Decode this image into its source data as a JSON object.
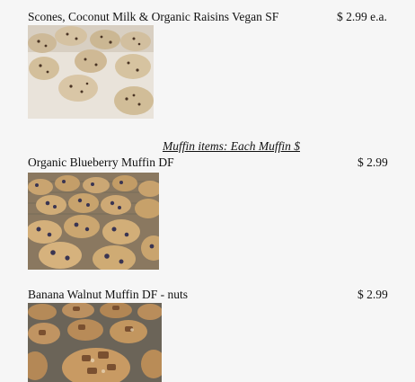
{
  "items": [
    {
      "name": "Scones, Coconut Milk & Organic Raisins Vegan SF",
      "price": "$ 2.99 e.a.",
      "photo": "scones-photo"
    },
    {
      "name": "Organic Blueberry Muffin DF",
      "price": "$ 2.99",
      "photo": "blueberry-muffins-photo"
    },
    {
      "name": "Banana Walnut Muffin DF - nuts",
      "price": "$ 2.99",
      "photo": "banana-walnut-muffins-photo"
    }
  ],
  "section": {
    "muffin_heading": "Muffin items: Each Muffin $"
  },
  "colors": {
    "background": "#f6f6f6",
    "text": "#111111"
  }
}
